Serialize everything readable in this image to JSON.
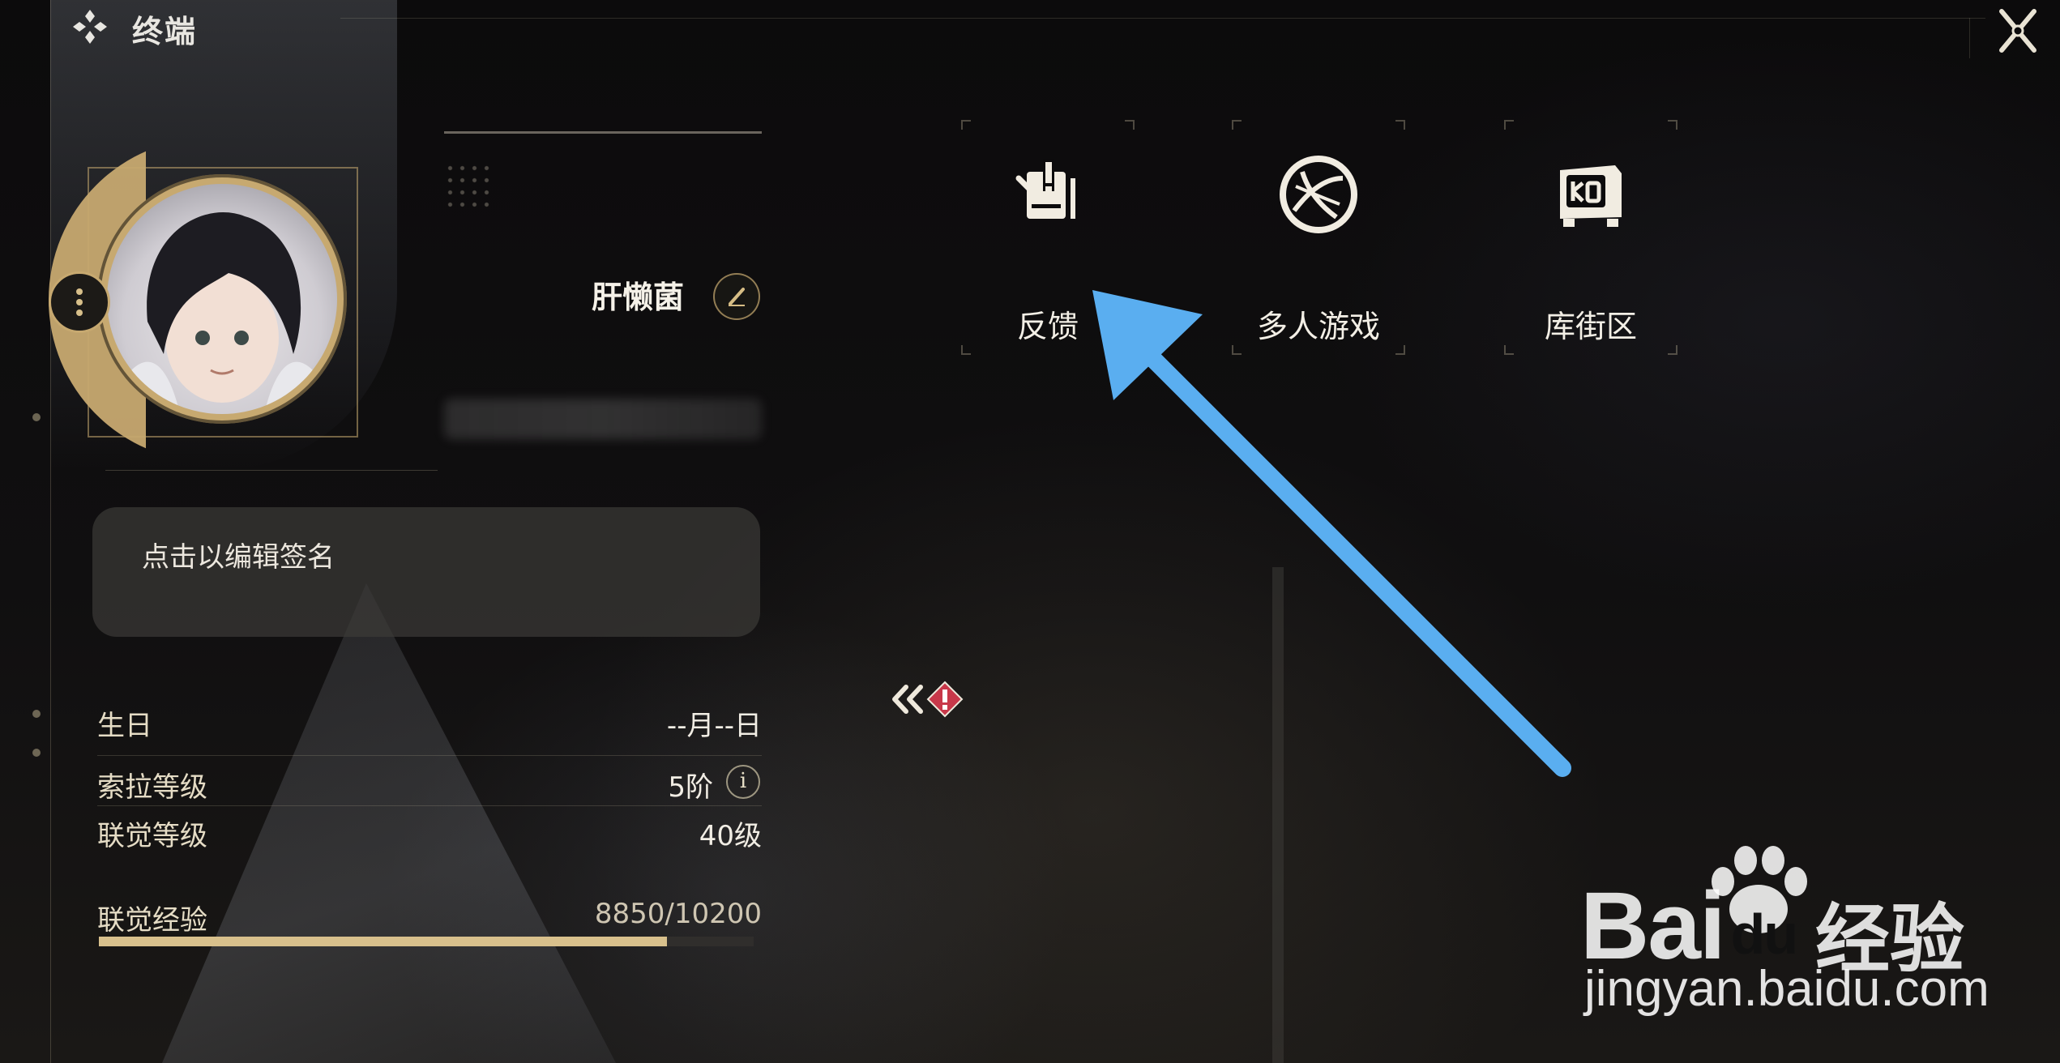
{
  "header": {
    "title": "终端"
  },
  "profile": {
    "username": "肝懒菌",
    "signature_placeholder": "点击以编辑签名",
    "stats": [
      {
        "label": "生日",
        "value": "--月--日"
      },
      {
        "label": "索拉等级",
        "value": "5阶"
      },
      {
        "label": "联觉等级",
        "value": "40级"
      }
    ],
    "experience": {
      "label": "联觉经验",
      "value_text": "8850/10200",
      "current": 8850,
      "max": 10200
    },
    "info_glyph": "i"
  },
  "menu": {
    "items": [
      {
        "label": "反馈",
        "icon": "feedback-icon"
      },
      {
        "label": "多人游戏",
        "icon": "globe-icon"
      },
      {
        "label": "库街区",
        "icon": "kujiequ-icon"
      }
    ]
  },
  "collapse": {
    "icon": "double-chevron-left-icon",
    "alert_icon": "alert-diamond-icon"
  },
  "watermark": {
    "brand": "Bai",
    "brand_suffix": "du",
    "cn": "经验",
    "url": "jingyan.baidu.com"
  },
  "colors": {
    "accent_gold": "#c7a970",
    "annotation_arrow": "#5aaef0",
    "alert_red": "#c8384a"
  }
}
